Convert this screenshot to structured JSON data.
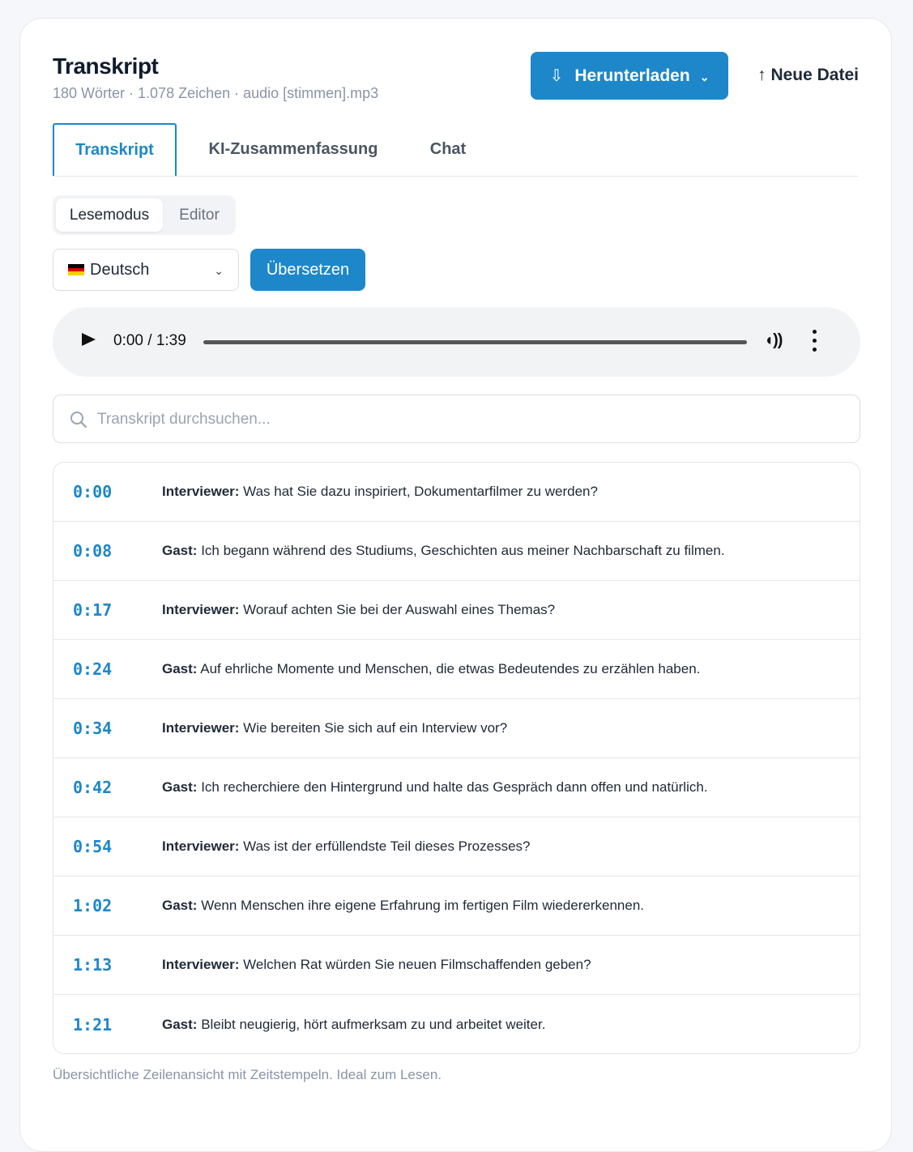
{
  "header": {
    "title": "Transkript",
    "meta": "180 Wörter · 1.078 Zeichen · audio [stimmen].mp3",
    "download_label": "Herunterladen",
    "new_file_label": "Neue Datei"
  },
  "tabs": [
    {
      "label": "Transkript",
      "active": true
    },
    {
      "label": "KI-Zusammenfassung",
      "active": false
    },
    {
      "label": "Chat",
      "active": false
    }
  ],
  "view_modes": [
    {
      "label": "Lesemodus",
      "active": true
    },
    {
      "label": "Editor",
      "active": false
    }
  ],
  "language": {
    "selected": "Deutsch",
    "translate_label": "Übersetzen"
  },
  "player": {
    "time": "0:00 / 1:39",
    "progress": 0
  },
  "search": {
    "placeholder": "Transkript durchsuchen..."
  },
  "transcript": [
    {
      "time": "0:00",
      "speaker": "Interviewer:",
      "text": "Was hat Sie dazu inspiriert, Dokumentarfilmer zu werden?"
    },
    {
      "time": "0:08",
      "speaker": "Gast:",
      "text": "Ich begann während des Studiums, Geschichten aus meiner Nachbarschaft zu filmen."
    },
    {
      "time": "0:17",
      "speaker": "Interviewer:",
      "text": "Worauf achten Sie bei der Auswahl eines Themas?"
    },
    {
      "time": "0:24",
      "speaker": "Gast:",
      "text": "Auf ehrliche Momente und Menschen, die etwas Bedeutendes zu erzählen haben."
    },
    {
      "time": "0:34",
      "speaker": "Interviewer:",
      "text": "Wie bereiten Sie sich auf ein Interview vor?"
    },
    {
      "time": "0:42",
      "speaker": "Gast:",
      "text": "Ich recherchiere den Hintergrund und halte das Gespräch dann offen und natürlich."
    },
    {
      "time": "0:54",
      "speaker": "Interviewer:",
      "text": "Was ist der erfüllendste Teil dieses Prozesses?"
    },
    {
      "time": "1:02",
      "speaker": "Gast:",
      "text": "Wenn Menschen ihre eigene Erfahrung im fertigen Film wiedererkennen."
    },
    {
      "time": "1:13",
      "speaker": "Interviewer:",
      "text": "Welchen Rat würden Sie neuen Filmschaffenden geben?"
    },
    {
      "time": "1:21",
      "speaker": "Gast:",
      "text": "Bleibt neugierig, hört aufmerksam zu und arbeitet weiter."
    }
  ],
  "footer_note": "Übersichtliche Zeilenansicht mit Zeitstempeln. Ideal zum Lesen.",
  "colors": {
    "accent": "#1d87c9"
  }
}
